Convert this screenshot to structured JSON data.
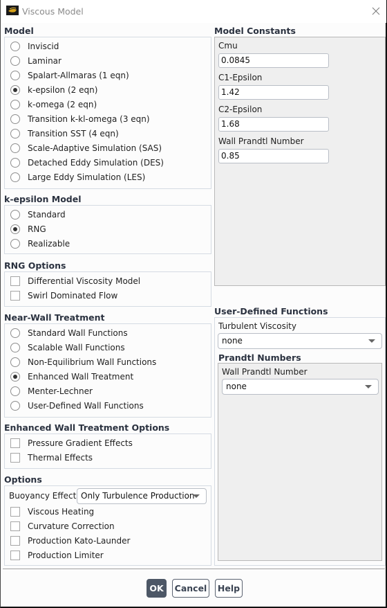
{
  "window": {
    "title": "Viscous Model",
    "icon": "fluent-logo-icon",
    "close_icon": "close-icon"
  },
  "model": {
    "title": "Model",
    "options": [
      {
        "label": "Inviscid",
        "selected": false
      },
      {
        "label": "Laminar",
        "selected": false
      },
      {
        "label": "Spalart-Allmaras (1 eqn)",
        "selected": false
      },
      {
        "label": "k-epsilon (2 eqn)",
        "selected": true
      },
      {
        "label": "k-omega (2 eqn)",
        "selected": false
      },
      {
        "label": "Transition k-kl-omega (3 eqn)",
        "selected": false
      },
      {
        "label": "Transition SST (4 eqn)",
        "selected": false
      },
      {
        "label": "Scale-Adaptive Simulation (SAS)",
        "selected": false
      },
      {
        "label": "Detached Eddy Simulation (DES)",
        "selected": false
      },
      {
        "label": "Large Eddy Simulation (LES)",
        "selected": false
      }
    ]
  },
  "kepsilon_model": {
    "title": "k-epsilon Model",
    "options": [
      {
        "label": "Standard",
        "selected": false
      },
      {
        "label": "RNG",
        "selected": true
      },
      {
        "label": "Realizable",
        "selected": false
      }
    ]
  },
  "rng_options": {
    "title": "RNG Options",
    "options": [
      {
        "label": "Differential Viscosity Model",
        "checked": false
      },
      {
        "label": "Swirl Dominated Flow",
        "checked": false
      }
    ]
  },
  "near_wall": {
    "title": "Near-Wall Treatment",
    "options": [
      {
        "label": "Standard Wall Functions",
        "selected": false
      },
      {
        "label": "Scalable Wall Functions",
        "selected": false
      },
      {
        "label": "Non-Equilibrium Wall Functions",
        "selected": false
      },
      {
        "label": "Enhanced Wall Treatment",
        "selected": true
      },
      {
        "label": "Menter-Lechner",
        "selected": false
      },
      {
        "label": "User-Defined Wall Functions",
        "selected": false
      }
    ]
  },
  "ewt_options": {
    "title": "Enhanced Wall Treatment Options",
    "options": [
      {
        "label": "Pressure Gradient Effects",
        "checked": false
      },
      {
        "label": "Thermal Effects",
        "checked": false
      }
    ]
  },
  "options": {
    "title": "Options",
    "buoyancy_label": "Buoyancy Effects",
    "buoyancy_value": "Only Turbulence Production",
    "checkboxes": [
      {
        "label": "Viscous Heating",
        "checked": false
      },
      {
        "label": "Curvature Correction",
        "checked": false
      },
      {
        "label": "Production Kato-Launder",
        "checked": false
      },
      {
        "label": "Production Limiter",
        "checked": false
      }
    ]
  },
  "model_constants": {
    "title": "Model Constants",
    "fields": [
      {
        "label": "Cmu",
        "value": "0.0845"
      },
      {
        "label": "C1-Epsilon",
        "value": "1.42"
      },
      {
        "label": "C2-Epsilon",
        "value": "1.68"
      },
      {
        "label": "Wall Prandtl Number",
        "value": "0.85"
      }
    ]
  },
  "udf": {
    "title": "User-Defined Functions",
    "turbulent_viscosity_label": "Turbulent Viscosity",
    "turbulent_viscosity_value": "none",
    "prandtl_title": "Prandtl Numbers",
    "wall_prandtl_label": "Wall Prandtl Number",
    "wall_prandtl_value": "none"
  },
  "buttons": {
    "ok": "OK",
    "cancel": "Cancel",
    "help": "Help"
  }
}
